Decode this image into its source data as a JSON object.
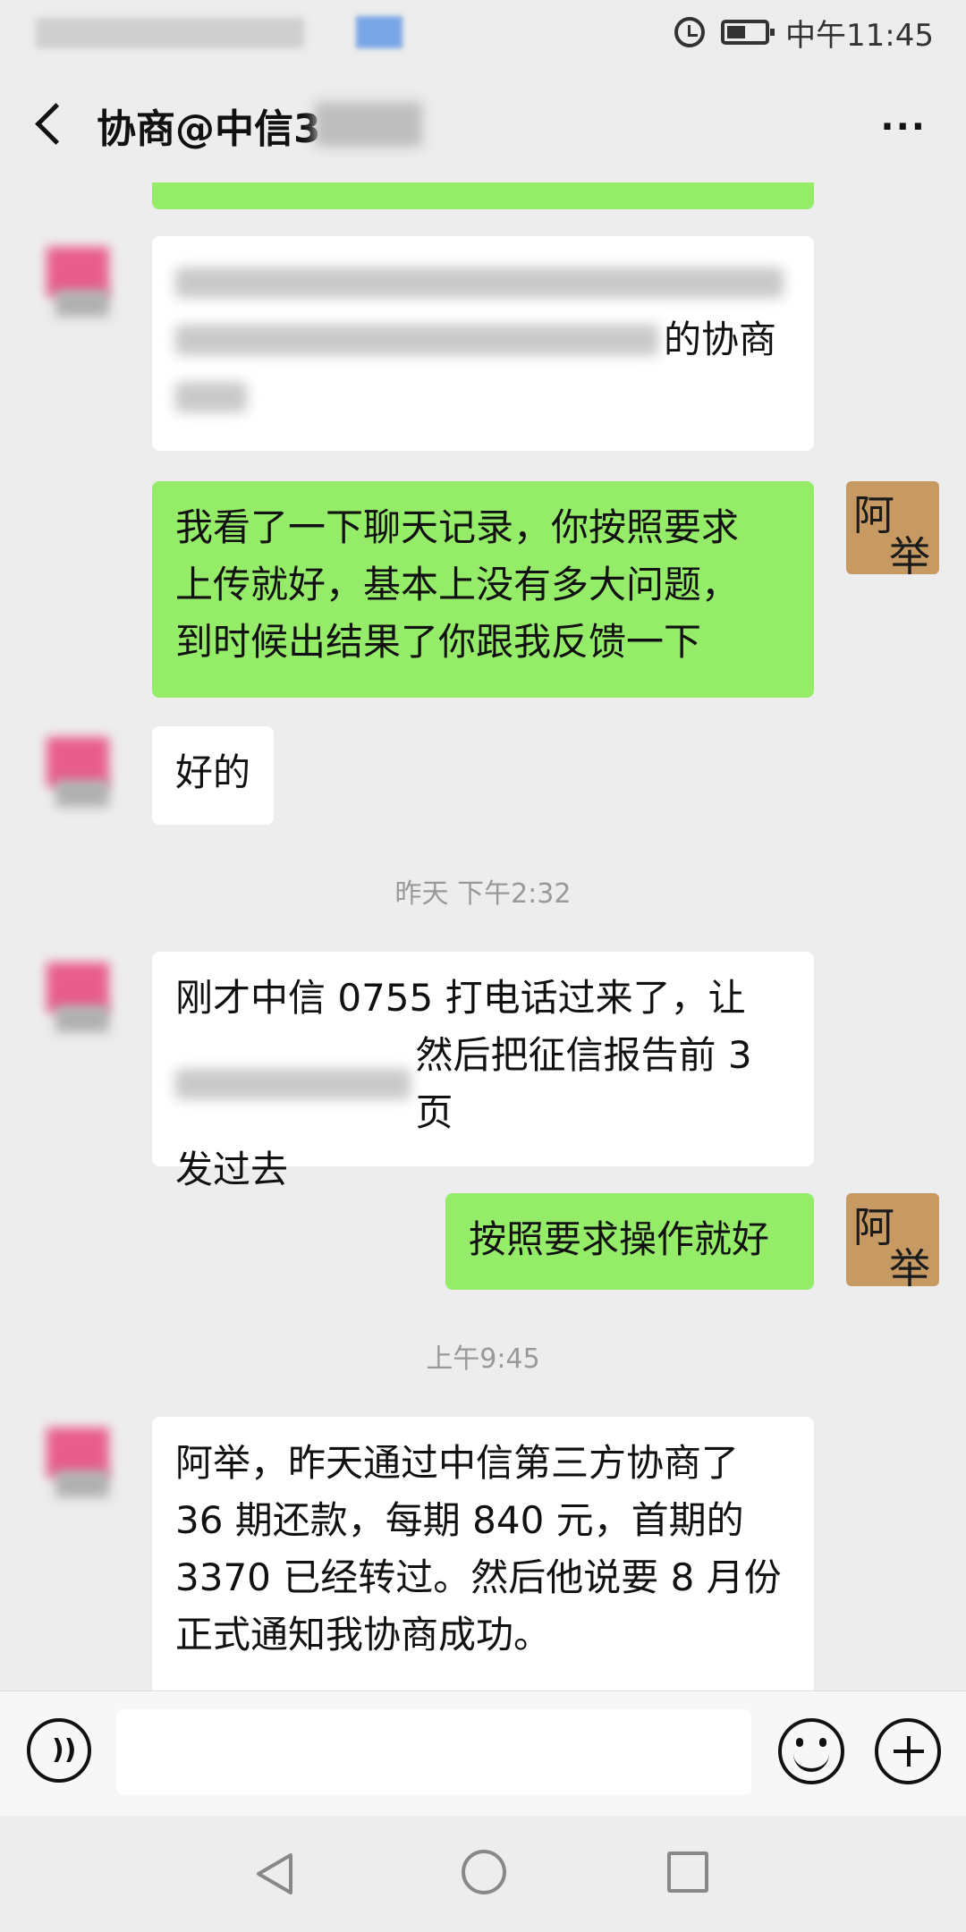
{
  "status_bar": {
    "time": "中午11:45"
  },
  "header": {
    "title": "协商@中信3",
    "more": "···"
  },
  "avatars": {
    "me": [
      "阿",
      "举"
    ]
  },
  "messages": {
    "m1_tail": "的协商",
    "m2": [
      "我看了一下聊天记录，你按照要求",
      "上传就好，基本上没有多大问题，",
      "到时候出结果了你跟我反馈一下"
    ],
    "m3": "好的",
    "ts1": "昨天 下午2:32",
    "m4": [
      "刚才中信 0755 打电话过来了，让",
      "然后把征信报告前 3 页",
      "发过去"
    ],
    "m5": "按照要求操作就好",
    "ts2": "上午9:45",
    "m6": [
      "阿举，昨天通过中信第三方协商了",
      "36 期还款，每期 840 元，首期的",
      "3370 已经转过。然后他说要 8 月份",
      "正式通知我协商成功。"
    ]
  },
  "input_bar": {
    "voice_symbol": "))"
  }
}
